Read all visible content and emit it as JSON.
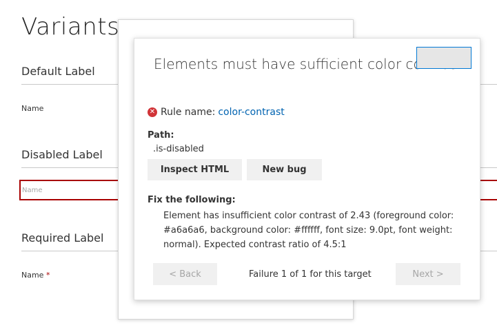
{
  "page": {
    "title": "Variants",
    "sections": [
      {
        "label": "Default Label",
        "field_label": "Name"
      },
      {
        "label": "Disabled Label",
        "field_placeholder": "Name"
      },
      {
        "label": "Required Label",
        "field_label": "Name",
        "required_marker": "*"
      }
    ]
  },
  "dialog": {
    "title": "Elements must have sufficient color contrast",
    "error_icon": "x-circle-icon",
    "rule_prefix": "Rule name:",
    "rule_name": "color-contrast",
    "path_label": "Path:",
    "path_value": ".is-disabled",
    "inspect_button": "Inspect HTML",
    "new_bug_button": "New bug",
    "fix_label": "Fix the following:",
    "fix_text": "Element has insufficient color contrast of 2.43 (foreground color: #a6a6a6, background color: #ffffff, font size: 9.0pt, font weight: normal). Expected contrast ratio of 4.5:1",
    "back_button": "< Back",
    "failure_text": "Failure 1 of 1 for this target",
    "next_button": "Next >"
  },
  "colors": {
    "error": "#a80000",
    "link": "#0063b1",
    "focus": "#0078d4",
    "disabled_text": "#a6a6a6"
  }
}
